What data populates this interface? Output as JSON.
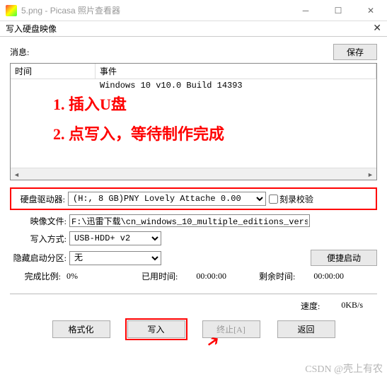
{
  "titlebar": {
    "title": "5.png - Picasa 照片查看器"
  },
  "subheader": {
    "title": "写入硬盘映像"
  },
  "msg": {
    "label": "消息:",
    "save": "保存"
  },
  "listview": {
    "col_time": "时间",
    "col_event": "事件",
    "row1_event": "Windows 10 v10.0 Build 14393"
  },
  "annot": {
    "a1": "1. 插入U盘",
    "a2": "2. 点写入，等待制作完成"
  },
  "drive": {
    "label": "硬盘驱动器:",
    "value": "(H:, 8 GB)PNY     Lovely Attache  0.00",
    "check_label": "刻录校验"
  },
  "image": {
    "label": "映像文件:",
    "value": "F:\\迅雷下载\\cn_windows_10_multiple_editions_version_1607_up"
  },
  "mode": {
    "label": "写入方式:",
    "value": "USB-HDD+ v2"
  },
  "hide": {
    "label": "隐藏启动分区:",
    "value": "无",
    "convenient": "便捷启动"
  },
  "status": {
    "done_label": "完成比例:",
    "done_val": "0%",
    "used_label": "已用时间:",
    "used_val": "00:00:00",
    "remain_label": "剩余时间:",
    "remain_val": "00:00:00"
  },
  "speed": {
    "label": "速度:",
    "value": "0KB/s"
  },
  "buttons": {
    "format": "格式化",
    "write": "写入",
    "abort": "终止[A]",
    "back": "返回"
  },
  "watermark": "CSDN @壳上有农"
}
